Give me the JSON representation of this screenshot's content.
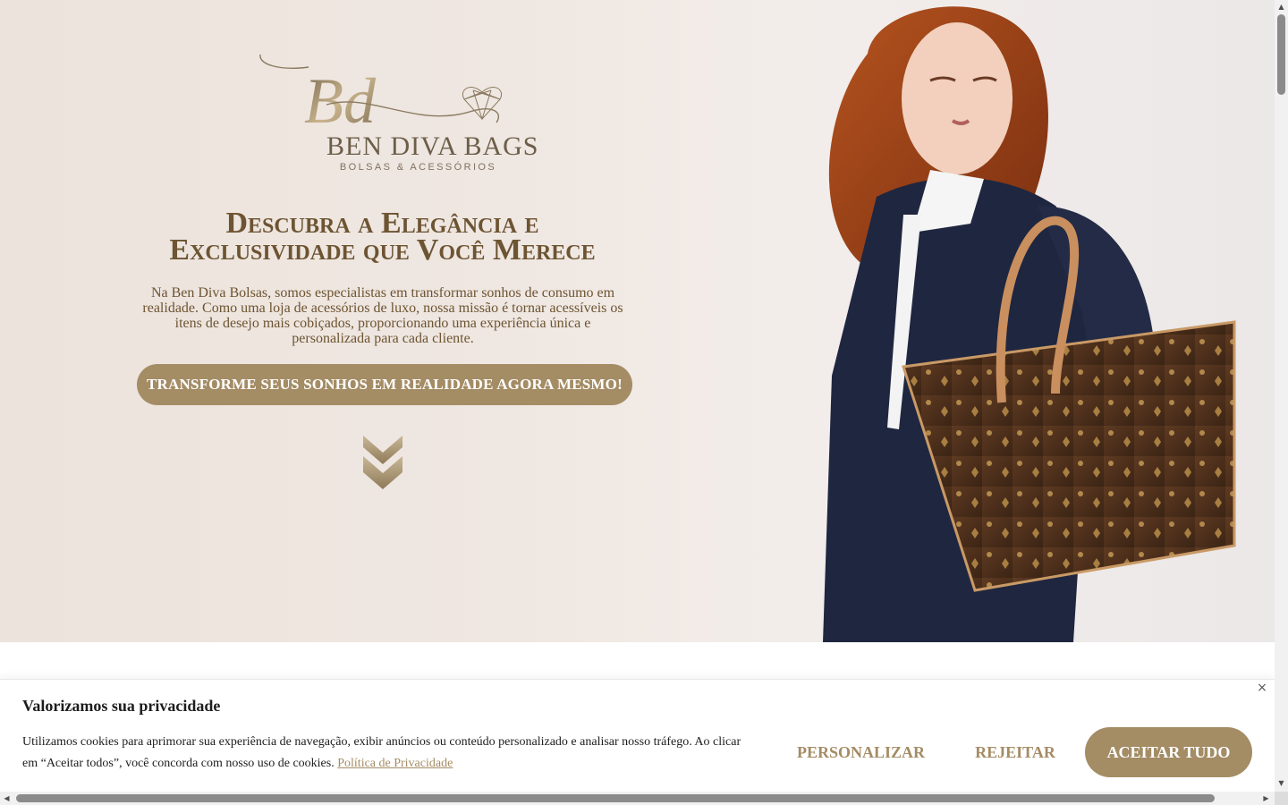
{
  "brand": {
    "monogram": "Bd",
    "name": "BEN DIVA BAGS",
    "tagline": "BOLSAS & ACESSÓRIOS"
  },
  "hero": {
    "headline_line1": "Descubra a Elegância e",
    "headline_line2": "Exclusividade que Você Merece",
    "intro": "Na Ben Diva Bolsas, somos especialistas em transformar sonhos de consumo em realidade. Como uma loja de acessórios de luxo, nossa missão é tornar acessíveis os itens de desejo mais cobiçados, proporcionando uma experiência única e personalizada para cada cliente.",
    "cta_label": "TRANSFORME SEUS SONHOS EM REALIDADE AGORA MESMO!",
    "scroll_icon": "double-chevron-down-icon"
  },
  "cookie_banner": {
    "title": "Valorizamos sua privacidade",
    "text": "Utilizamos cookies para aprimorar sua experiência de navegação, exibir anúncios ou conteúdo personalizado e analisar nosso tráfego. Ao clicar em “Aceitar todos”, você concorda com nosso uso de cookies.",
    "policy_link": "Política de Privacidade",
    "close_icon": "×",
    "buttons": {
      "customize": "PERSONALIZAR",
      "reject": "REJEITAR",
      "accept": "ACEITAR TUDO"
    }
  },
  "colors": {
    "accent": "#a48c65",
    "headline": "#6d5432",
    "hero_bg": "#ece3dc"
  }
}
